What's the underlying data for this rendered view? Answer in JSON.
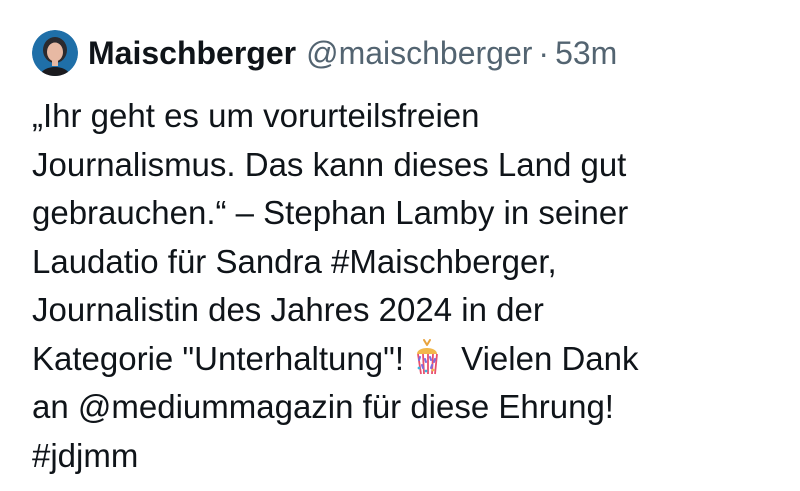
{
  "tweet": {
    "author_name": "Maischberger",
    "handle": "@maischberger",
    "separator": "·",
    "time": "53m",
    "lines": {
      "l1": "„Ihr geht es um vorurteilsfreien",
      "l2": "Journalismus. Das kann dieses Land gut",
      "l3": "gebrauchen.“ – Stephan Lamby in seiner",
      "l4_pre": "Laudatio für Sandra ",
      "l4_tag": "#Maischberger",
      "l4_post": ",",
      "l5": "Journalistin des Jahres 2024 in der",
      "l6_pre": "Kategorie \"Unterhaltung\"!",
      "l6_post": " Vielen Dank",
      "l7_pre": "an ",
      "l7_mention": "@mediummagazin",
      "l7_post": " für diese Ehrung!",
      "l8_tag": "#jdjmm"
    },
    "emoji": "confetti-ball-icon",
    "colors": {
      "text": "#0f1419",
      "secondary": "#536471"
    }
  }
}
